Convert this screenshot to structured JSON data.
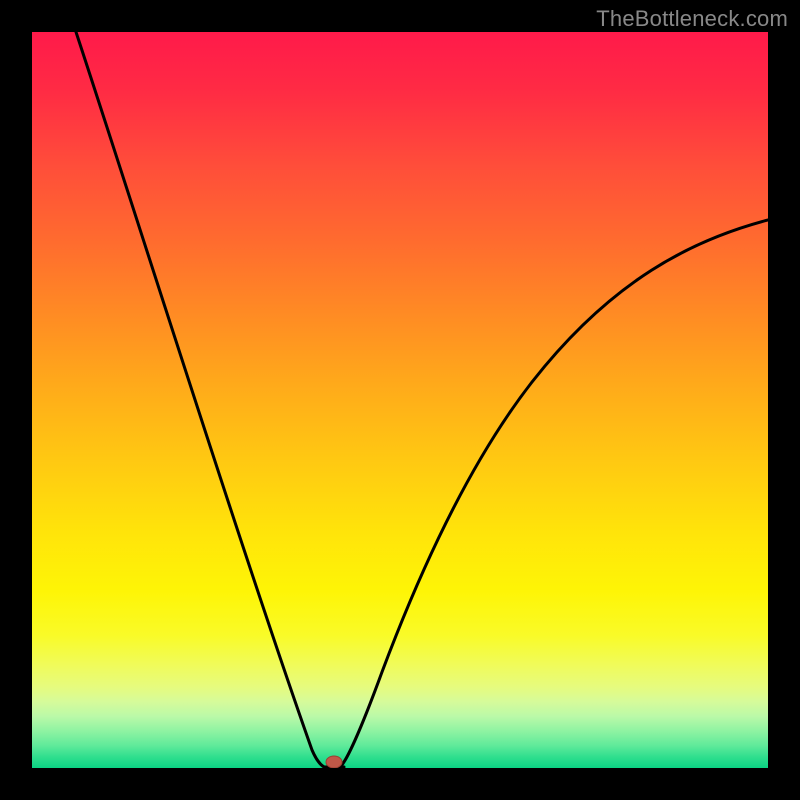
{
  "watermark": "TheBottleneck.com",
  "chart_data": {
    "type": "line",
    "title": "",
    "xlabel": "",
    "ylabel": "",
    "xlim": [
      0,
      736
    ],
    "ylim": [
      0,
      736
    ],
    "grid": false,
    "series": [
      {
        "name": "bottleneck-curve",
        "x_min_point": 294,
        "left_top_y": 0,
        "right_end": {
          "x": 736,
          "y": 188
        },
        "color": "#000000"
      }
    ],
    "marker": {
      "x": 302,
      "y": 730,
      "rx": 8,
      "ry": 6,
      "color": "#c05848"
    },
    "gradient_stops": [
      {
        "pos": 0.0,
        "color": "#ff1a4a"
      },
      {
        "pos": 0.5,
        "color": "#ffaa1a"
      },
      {
        "pos": 0.75,
        "color": "#fef506"
      },
      {
        "pos": 1.0,
        "color": "#0bd384"
      }
    ]
  }
}
